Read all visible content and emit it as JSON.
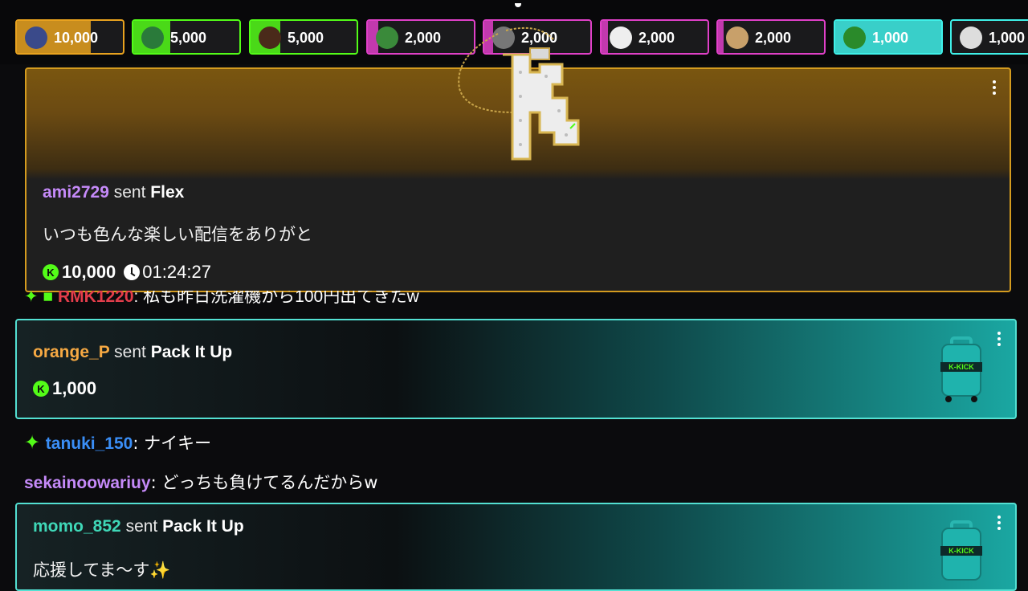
{
  "gift_bar": {
    "chips": [
      {
        "amount": "10,000",
        "avatar_icon": "astronaut-avatar-icon",
        "accent": "#e8a21f",
        "fill_fraction": 0.7
      },
      {
        "amount": "5,000",
        "avatar_icon": "green-face-avatar-icon",
        "accent": "#53fc18",
        "fill_fraction": 0.35
      },
      {
        "amount": "5,000",
        "avatar_icon": "mouse-avatar-icon",
        "accent": "#53fc18",
        "fill_fraction": 0.28
      },
      {
        "amount": "2,000",
        "avatar_icon": "pepe-avatar-icon",
        "accent": "#e040c8",
        "fill_fraction": 0.1
      },
      {
        "amount": "2,000",
        "avatar_icon": "gray-avatar-icon",
        "accent": "#e040c8",
        "fill_fraction": 0.08
      },
      {
        "amount": "2,000",
        "avatar_icon": "mickey-avatar-icon",
        "accent": "#e040c8",
        "fill_fraction": 0.06
      },
      {
        "amount": "2,000",
        "avatar_icon": "animal-avatar-icon",
        "accent": "#e040c8",
        "fill_fraction": 0.05
      },
      {
        "amount": "1,000",
        "avatar_icon": "green-avatar-icon",
        "accent": "#3ff0e8",
        "fill_fraction": 1.0
      },
      {
        "amount": "1,000",
        "avatar_icon": "white-avatar-icon",
        "accent": "#3ff0e8",
        "fill_fraction": 0.0
      }
    ]
  },
  "flex_card": {
    "username": "ami2729",
    "username_color": "#c58af9",
    "sent_word": "sent",
    "gift_name": "Flex",
    "message": "いつも色んな楽しい配信をありがと",
    "amount": "10,000",
    "timer": "01:24:27",
    "accent": "#d49b1f"
  },
  "hidden_line": {
    "username": "RMK1220",
    "username_color": "#e33d4b",
    "text": ": 私も昨日洗濯機から100円出てきたw"
  },
  "pack_card_1": {
    "username": "orange_P",
    "username_color": "#f6a943",
    "sent_word": "sent",
    "gift_name": "Pack It Up",
    "amount": "1,000"
  },
  "chat_lines": [
    {
      "username": "tanuki_150",
      "username_color": "#3a8ef6",
      "text": ": ナイキー",
      "badge": "sparkle-badge-icon"
    },
    {
      "username": "sekainoowariuy",
      "username_color": "#c58af9",
      "text": ": どっちも負けてるんだからw"
    }
  ],
  "pack_card_2": {
    "username": "momo_852",
    "username_color": "#3fd8b8",
    "sent_word": "sent",
    "gift_name": "Pack It Up",
    "message": "応援してま〜す✨"
  },
  "suitcase_label": "K-KICK",
  "colors": {
    "kick_green": "#53fc18",
    "teal": "#53e0d2",
    "gold": "#d49b1f"
  }
}
